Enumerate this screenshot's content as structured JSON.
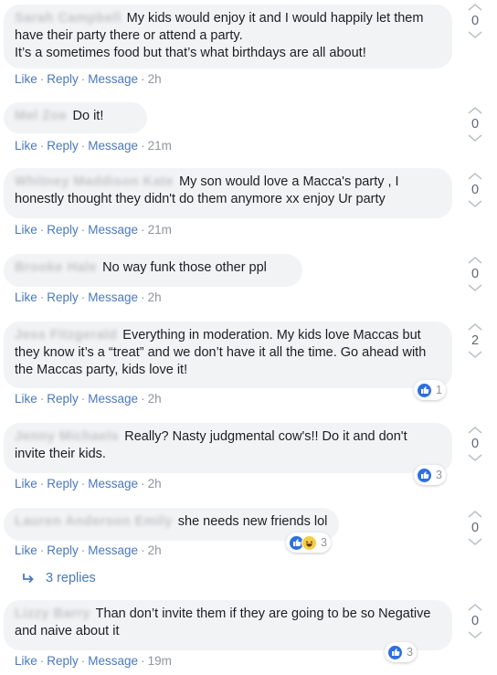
{
  "actions": {
    "like": "Like",
    "reply": "Reply",
    "message": "Message",
    "separator": "·"
  },
  "comments": [
    {
      "author": "Sarah Campbell",
      "text": "My kids would enjoy it and I would happily let them have their party there or attend a party.\nIt’s a sometimes food but that’s what birthdays are all about!",
      "time": "2h",
      "votes": "0",
      "reactions": null
    },
    {
      "author": "Mel Zoe",
      "text": "Do it!",
      "time": "21m",
      "votes": "0",
      "reactions": null
    },
    {
      "author": "Whitney Maddison Kate",
      "text": "My son would love a Macca's party , I honestly thought they didn't do them anymore xx enjoy Ur party",
      "time": "21m",
      "votes": "0",
      "reactions": null
    },
    {
      "author": "Brooke Hale",
      "text": "No way funk those other ppl",
      "time": "2h",
      "votes": "0",
      "reactions": null
    },
    {
      "author": "Jess Fitzgerald",
      "text": "Everything in moderation. My kids love Maccas but they know it’s a “treat” and we don’t have it all the time. Go ahead with the Maccas party, kids love it!",
      "time": "2h",
      "votes": "2",
      "reactions": {
        "count": "1",
        "types": [
          "like"
        ]
      }
    },
    {
      "author": "Jenny Michaels",
      "text": "Really? Nasty judgmental cow's!! Do it and don't invite their kids.",
      "time": "2h",
      "votes": "0",
      "reactions": {
        "count": "3",
        "types": [
          "like"
        ]
      }
    },
    {
      "author": "Lauren Anderson Emily",
      "text": "she needs new friends lol",
      "time": "2h",
      "votes": "0",
      "reactions": {
        "count": "3",
        "types": [
          "like",
          "haha"
        ]
      }
    },
    {
      "author": "Lizzy Barry",
      "text": "Than don’t invite them if they are going to be so Negative and naive about it",
      "time": "19m",
      "votes": "0",
      "reactions": {
        "count": "3",
        "types": [
          "like"
        ]
      }
    }
  ],
  "replies": {
    "label": "3 replies"
  },
  "colors": {
    "bubble": "#f2f3f5",
    "link": "#4a78be",
    "meta": "#90949c",
    "like_blue": "#2d6fe0",
    "haha_yellow": "#f7cc45"
  },
  "icons": {
    "upvote": "chevron-up-icon",
    "downvote": "chevron-down-icon",
    "reply_arrow": "reply-arrow-icon",
    "like": "thumbs-up-icon",
    "haha": "laughing-face-icon"
  }
}
